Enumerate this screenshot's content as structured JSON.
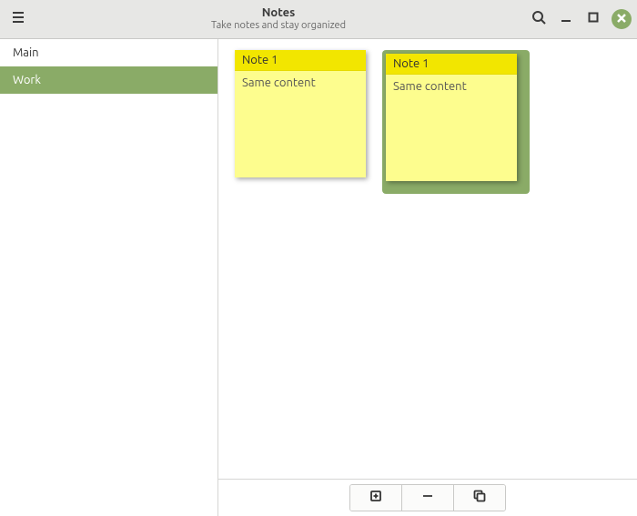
{
  "header": {
    "title": "Notes",
    "subtitle": "Take notes and stay organized"
  },
  "sidebar": {
    "items": [
      {
        "label": "Main",
        "selected": false
      },
      {
        "label": "Work",
        "selected": true
      }
    ]
  },
  "notes": [
    {
      "title": "Note 1",
      "body": "Same content",
      "selected": false
    },
    {
      "title": "Note 1",
      "body": "Same content",
      "selected": true
    }
  ],
  "icons": {
    "hamburger": "hamburger-icon",
    "search": "search-icon",
    "minimize": "minimize-icon",
    "maximize": "maximize-icon",
    "close": "close-icon",
    "add_note": "add-note-icon",
    "remove_note": "remove-note-icon",
    "duplicate_note": "duplicate-note-icon"
  },
  "colors": {
    "accent": "#8aab67",
    "note_bg": "#fdfd8e",
    "note_title_bg": "#f2e600"
  }
}
